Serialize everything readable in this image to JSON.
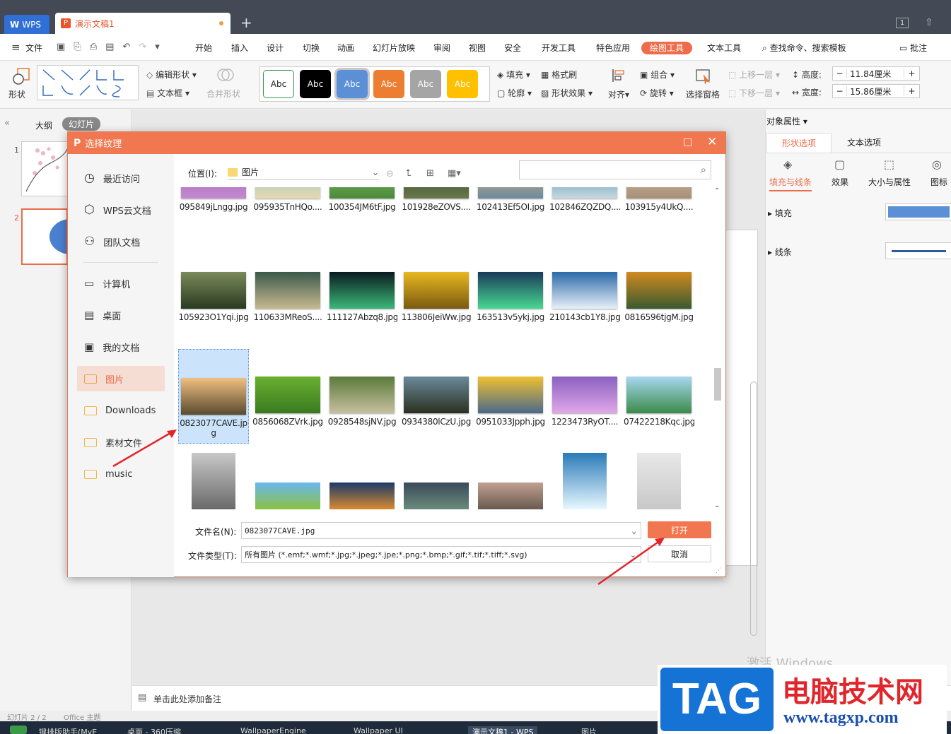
{
  "app": {
    "wps_tab": "WPS",
    "doc_tab": "演示文稿1",
    "tab_count": "1"
  },
  "menu": [
    "文件",
    "开始",
    "插入",
    "设计",
    "切换",
    "动画",
    "幻灯片放映",
    "审阅",
    "视图",
    "安全",
    "开发工具",
    "特色应用",
    "绘图工具",
    "文本工具",
    "查找命令、搜索模板",
    "批注"
  ],
  "ribbon": {
    "shape": "形状",
    "edit_shape": "编辑形状",
    "textbox": "文本框",
    "merge_shape": "合并形状",
    "styles": [
      "Abc",
      "Abc",
      "Abc",
      "Abc",
      "Abc",
      "Abc"
    ],
    "fill": "填充",
    "format_brush": "格式刷",
    "outline": "轮廓",
    "shape_effect": "形状效果",
    "align": "对齐",
    "group": "组合",
    "rotate": "旋转",
    "select_pane": "选择窗格",
    "bring_forward": "上移一层",
    "send_backward": "下移一层",
    "height_label": "高度:",
    "height_value": "11.84厘米",
    "width_label": "宽度:",
    "width_value": "15.86厘米"
  },
  "left_panel": {
    "tab_outline": "大纲",
    "tab_slides": "幻灯片",
    "slide_nums": [
      "1",
      "2"
    ]
  },
  "notes": "单击此处添加备注",
  "right_panel": {
    "title": "对象属性",
    "tabs": [
      "形状选项",
      "文本选项"
    ],
    "sub": [
      "填充与线条",
      "效果",
      "大小与属性",
      "图标"
    ],
    "fill": "填充",
    "line": "线条",
    "watermark": "激活 Windows"
  },
  "dialog": {
    "title": "选择纹理",
    "nav": [
      "最近访问",
      "WPS云文档",
      "团队文档",
      "计算机",
      "桌面",
      "我的文档",
      "图片",
      "Downloads",
      "素材文件",
      "music"
    ],
    "location_label": "位置(I):",
    "location_value": "图片",
    "search_placeholder": "",
    "rows": [
      [
        "095849jLngg.jpg",
        "095935TnHQo....",
        "100354JM6tF.jpg",
        "101928eZOVS....",
        "102413Ef5OI.jpg",
        "102846ZQZDQ....",
        "103915y4UkQ...."
      ],
      [
        "105923O1Yqi.jpg",
        "110633MReoS....",
        "111127Abzq8.jpg",
        "113806JeiWw.jpg",
        "163513v5ykj.jpg",
        "210143cb1Y8.jpg",
        "0816596tjgM.jpg"
      ],
      [
        "0823077CAVE.jpg",
        "0856068ZVrk.jpg",
        "0928548sjNV.jpg",
        "0934380lCzU.jpg",
        "0951033Jpph.jpg",
        "1223473RyOT....",
        "07422218Kqc.jpg"
      ]
    ],
    "filename_label": "文件名(N):",
    "filename_value": "0823077CAVE.jpg",
    "filetype_label": "文件类型(T):",
    "filetype_value": "所有图片 (*.emf;*.wmf;*.jpg;*.jpeg;*.jpe;*.png;*.bmp;*.gif;*.tif;*.tiff;*.svg)",
    "open": "打开",
    "cancel": "取消"
  },
  "taskbar": [
    "键排版助手(MyE",
    "桌面 - 360压缩",
    "WallpaperEngine",
    "Wallpaper UI",
    "演示文稿1 - WPS",
    "图片"
  ],
  "status": [
    "幻灯片 2 / 2",
    "Office 主题"
  ],
  "brand": {
    "tag": "TAG",
    "cn": "电脑技术网",
    "url": "www.tagxp.com"
  },
  "colors": {
    "accent": "#f0774f",
    "wps_blue": "#2f6fd6"
  }
}
